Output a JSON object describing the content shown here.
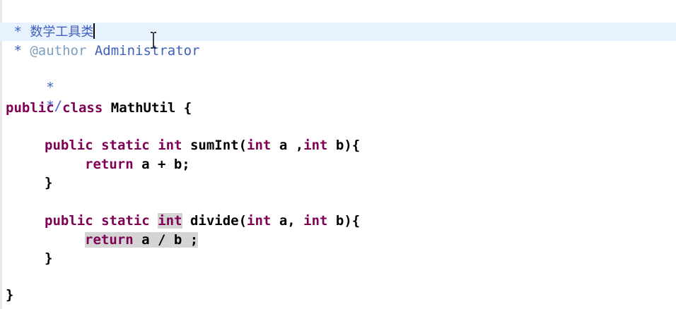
{
  "editor": {
    "line_comment_open": "/**",
    "line_doc_title": {
      "prefix": " * ",
      "text": "数学工具类"
    },
    "line_author": {
      "prefix": " * ",
      "tag": "@author",
      "value": " Administrator"
    },
    "line_blank_star": " *",
    "line_comment_close": " */",
    "class_decl": {
      "kw1": "public",
      "kw2": "class",
      "name": "MathUtil {"
    },
    "sum_method": {
      "kw1": "public",
      "kw2": "static",
      "kw3": "int",
      "name": "sumInt(",
      "p1_kw": "int",
      "p1_rest": " a ,",
      "p2_kw": "int",
      "p2_rest": " b){",
      "ret_kw": "return",
      "ret_expr": " a + b;",
      "close": "}"
    },
    "divide_method": {
      "kw1": "public",
      "kw2": "static",
      "kw3": "int",
      "name": "divide(",
      "p1_kw": "int",
      "p1_rest": " a, ",
      "p2_kw": "int",
      "p2_rest": " b){",
      "ret_kw": "return",
      "ret_expr": " a / b ;",
      "close": "}"
    },
    "class_close": "}"
  }
}
